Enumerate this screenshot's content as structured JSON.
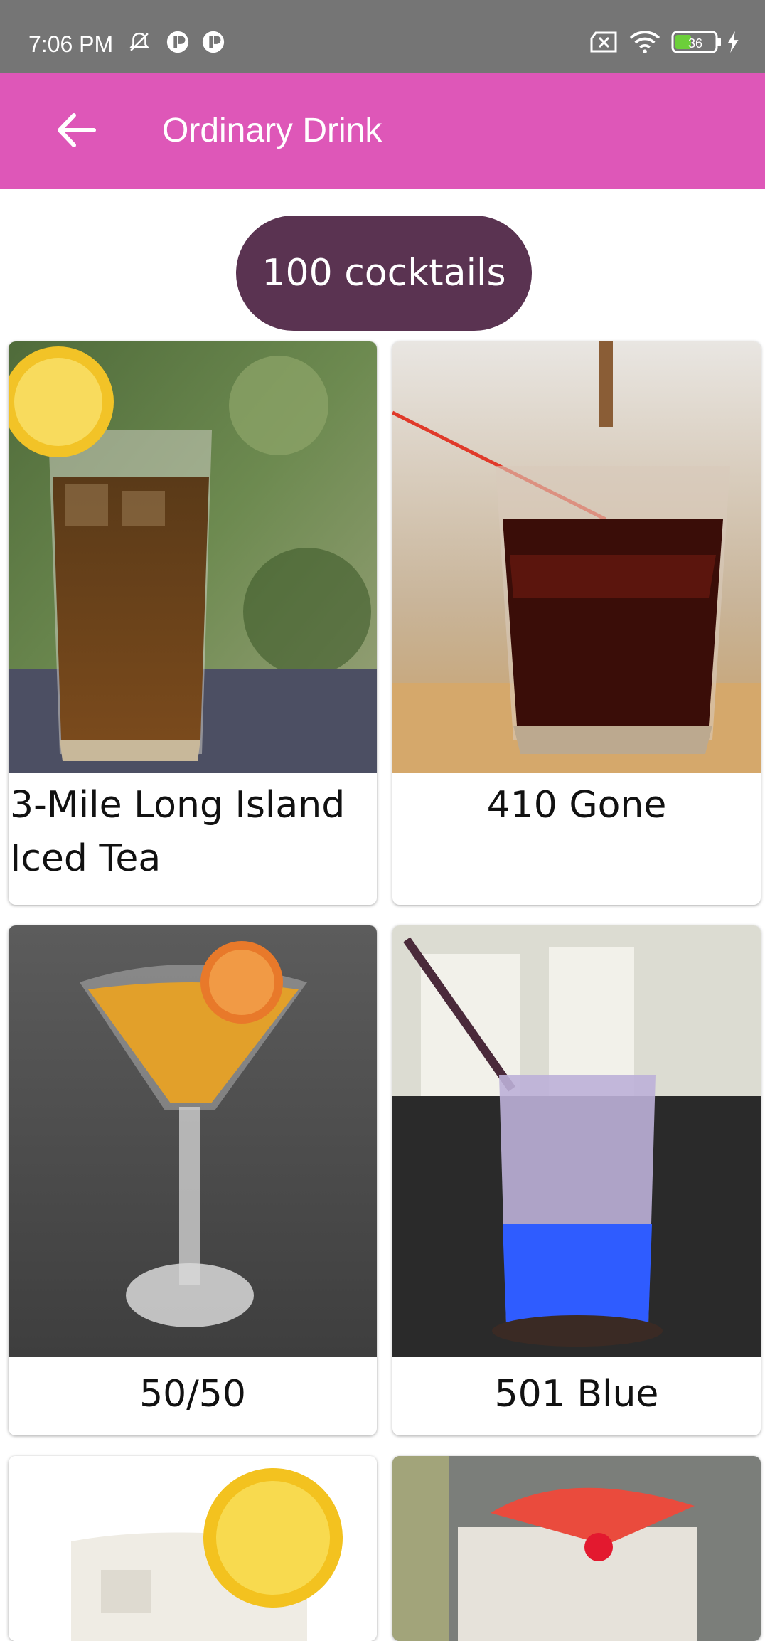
{
  "status_bar": {
    "time": "7:06 PM",
    "battery_level": "36",
    "icons": [
      "notifications-off-icon",
      "app-icon",
      "app-icon",
      "sim-none-icon",
      "wifi-icon",
      "battery-icon",
      "charging-icon"
    ]
  },
  "app_bar": {
    "title": "Ordinary Drink",
    "back_icon": "arrow-left-icon"
  },
  "count_badge": {
    "label": "100 cocktails"
  },
  "drinks": [
    {
      "name": "3-Mile Long Island Iced Tea"
    },
    {
      "name": "410 Gone"
    },
    {
      "name": "50/50"
    },
    {
      "name": "501 Blue"
    },
    {
      "name": ""
    },
    {
      "name": ""
    }
  ],
  "colors": {
    "status_bar": "#757575",
    "app_bar": "#de57b8",
    "badge": "#5a3351"
  }
}
